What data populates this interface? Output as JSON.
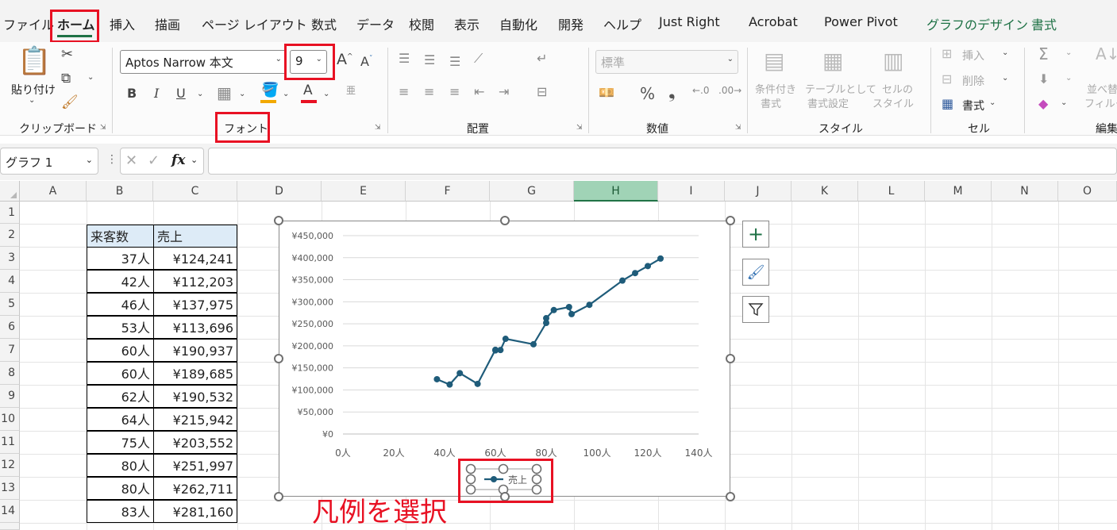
{
  "ribbon_tabs": [
    "ファイル",
    "ホーム",
    "挿入",
    "描画",
    "ページ レイアウト",
    "数式",
    "データ",
    "校閲",
    "表示",
    "自動化",
    "開発",
    "ヘルプ",
    "Just Right",
    "Acrobat",
    "Power Pivot",
    "グラフのデザイン",
    "書式"
  ],
  "active_tab": "ホーム",
  "clipboard": {
    "paste_label": "貼り付け",
    "group_label": "クリップボード"
  },
  "font": {
    "name": "Aptos Narrow 本文",
    "size": "9",
    "group_label": "フォント",
    "bold": "B",
    "italic": "I",
    "underline": "U",
    "grow": "A",
    "shrink": "A",
    "font_color": "A",
    "phonetic": "亜"
  },
  "alignment": {
    "group_label": "配置"
  },
  "number": {
    "format": "標準",
    "percent": "%",
    "comma": "❟",
    "group_label": "数値"
  },
  "styles": {
    "conditional": "条件付き\n書式",
    "conditional_1": "条件付き",
    "conditional_2": "書式",
    "table_1": "テーブルとして",
    "table_2": "書式設定",
    "cell_1": "セルの",
    "cell_2": "スタイル",
    "group_label": "スタイル"
  },
  "cells": {
    "insert": "挿入",
    "delete": "削除",
    "format": "書式",
    "group_label": "セル"
  },
  "editing": {
    "sort_1": "並べ替",
    "sort_2": "フィルタ",
    "group_label": "編集"
  },
  "name_box": "グラフ 1",
  "fx_label": "fx",
  "columns": [
    "A",
    "B",
    "C",
    "D",
    "E",
    "F",
    "G",
    "H",
    "I",
    "J",
    "K",
    "L",
    "M",
    "N",
    "O"
  ],
  "selected_column": "H",
  "rows": [
    "1",
    "2",
    "3",
    "4",
    "5",
    "6",
    "7",
    "8",
    "9",
    "10",
    "11",
    "12",
    "13",
    "14"
  ],
  "table": {
    "headers": [
      "来客数",
      "売上"
    ],
    "rows": [
      [
        "37人",
        "¥124,241"
      ],
      [
        "42人",
        "¥112,203"
      ],
      [
        "46人",
        "¥137,975"
      ],
      [
        "53人",
        "¥113,696"
      ],
      [
        "60人",
        "¥190,937"
      ],
      [
        "60人",
        "¥189,685"
      ],
      [
        "62人",
        "¥190,532"
      ],
      [
        "64人",
        "¥215,942"
      ],
      [
        "75人",
        "¥203,552"
      ],
      [
        "80人",
        "¥251,997"
      ],
      [
        "80人",
        "¥262,711"
      ],
      [
        "83人",
        "¥281,160"
      ]
    ]
  },
  "chart_data": {
    "type": "scatter",
    "title": "",
    "xlabel": "",
    "ylabel": "",
    "xlim": [
      0,
      140
    ],
    "ylim": [
      0,
      450000
    ],
    "x_ticks": [
      "0人",
      "20人",
      "40人",
      "60人",
      "80人",
      "100人",
      "120人",
      "140人"
    ],
    "y_ticks": [
      "¥0",
      "¥50,000",
      "¥100,000",
      "¥150,000",
      "¥200,000",
      "¥250,000",
      "¥300,000",
      "¥350,000",
      "¥400,000",
      "¥450,000"
    ],
    "grid": true,
    "legend": "bottom",
    "series": [
      {
        "name": "売上",
        "color": "#1f5c7a",
        "x": [
          37,
          42,
          46,
          53,
          60,
          60,
          62,
          64,
          75,
          80,
          80,
          83,
          89,
          90,
          97,
          110,
          115,
          120,
          125
        ],
        "y": [
          124241,
          112203,
          137975,
          113696,
          190937,
          189685,
          190532,
          215942,
          203552,
          251997,
          262711,
          281160,
          288000,
          272000,
          293000,
          348000,
          365000,
          381000,
          398000
        ]
      }
    ]
  },
  "annotation": "凡例を選択",
  "colors": {
    "accent_green": "#1e7145",
    "highlight_red": "#e81123",
    "series": "#1f5c7a",
    "table_header": "#ddebf7"
  }
}
